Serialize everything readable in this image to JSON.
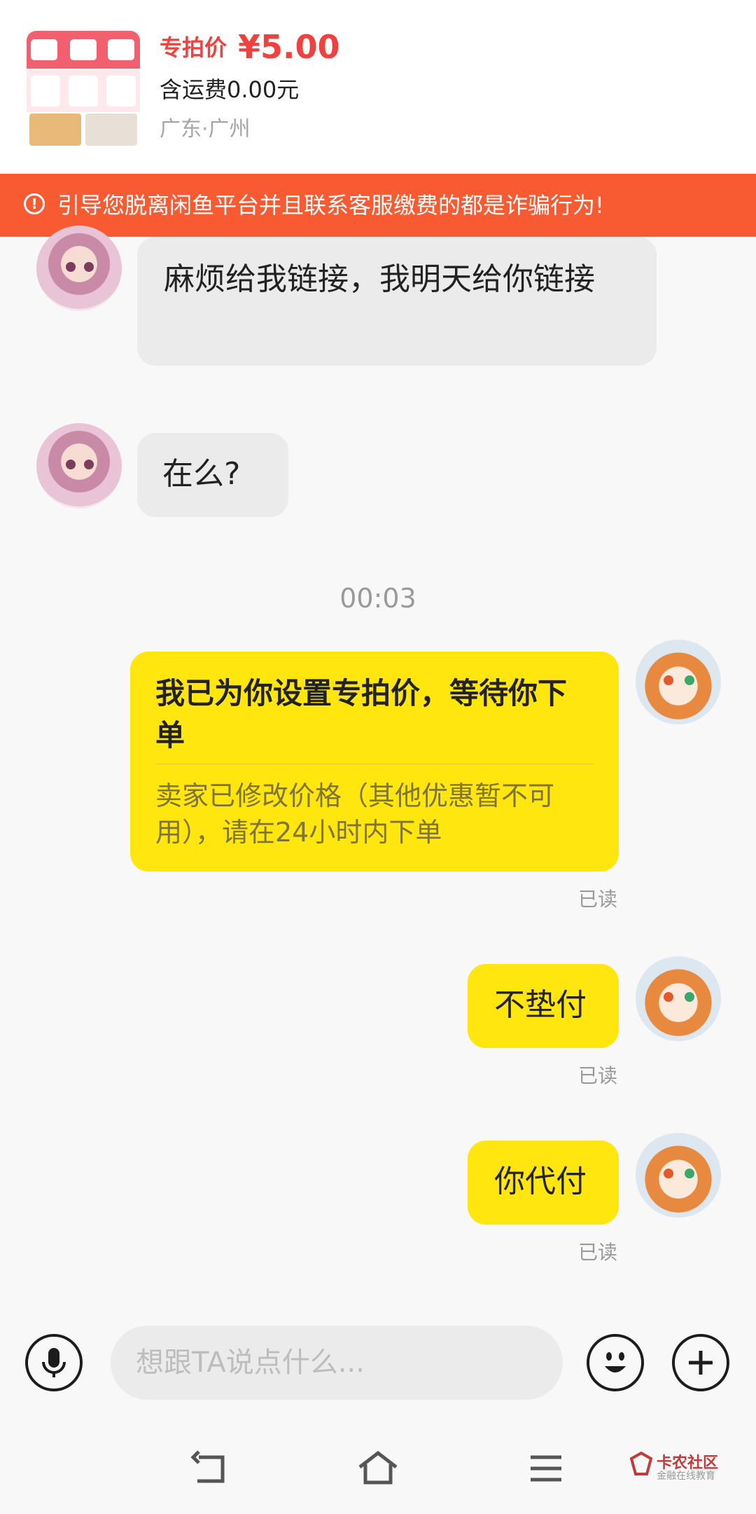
{
  "product": {
    "price_label": "专拍价",
    "price_value": "¥5.00",
    "shipping": "含运费0.00元",
    "location": "广东·广州"
  },
  "warning": {
    "text": "引导您脱离闲鱼平台并且联系客服缴费的都是诈骗行为!",
    "icon": "exclamation-circle-icon"
  },
  "messages": {
    "msg1": "麻烦给我链接，我明天给你链接",
    "msg2": "在么?",
    "timestamp": "00:03",
    "card_title": "我已为你设置专拍价，等待你下单",
    "card_desc": "卖家已修改价格（其他优惠暂不可用），请在24小时内下单",
    "read_label": "已读",
    "msg4": "不垫付",
    "msg5": "你代付"
  },
  "input": {
    "placeholder": "想跟TA说点什么..."
  },
  "icons": {
    "mic": "microphone-icon",
    "emoji": "emoji-icon",
    "plus": "plus-icon",
    "back": "back-icon",
    "home": "home-icon",
    "menu": "menu-icon"
  },
  "watermark": {
    "name": "卡农社区",
    "sub": "金融在线教育"
  },
  "colors": {
    "price": "#f0413e",
    "warning_bg": "#f85a32",
    "outgoing_bubble": "#ffe60f",
    "incoming_bubble": "#ebebeb"
  }
}
